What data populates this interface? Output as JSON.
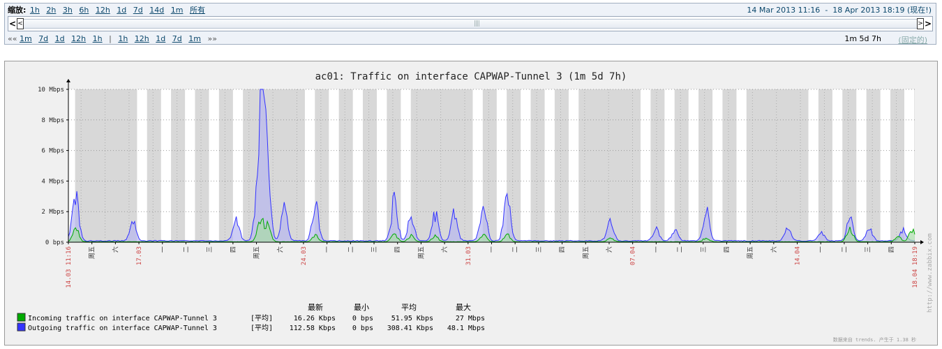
{
  "zoom": {
    "label": "缩放:",
    "links": [
      "1h",
      "2h",
      "3h",
      "6h",
      "12h",
      "1d",
      "7d",
      "14d",
      "1m",
      "所有"
    ]
  },
  "period": {
    "from": "14 Mar 2013 11:16",
    "separator": "-",
    "to": "18 Apr 2013 18:19 (现在!)"
  },
  "nav": {
    "back_prefix": "««",
    "back_links": [
      "1m",
      "7d",
      "1d",
      "12h",
      "1h"
    ],
    "divider": "|",
    "fwd_links": [
      "1h",
      "12h",
      "1d",
      "7d",
      "1m"
    ],
    "fwd_suffix": "»»",
    "duration": "1m 5d 7h",
    "fixed": "(固定的)"
  },
  "graph": {
    "title": "ac01: Traffic on interface CAPWAP-Tunnel 3 (1m 5d 7h)",
    "y_ticks": [
      "0 bps",
      "2 Mbps",
      "4 Mbps",
      "6 Mbps",
      "8 Mbps",
      "10 Mbps"
    ],
    "x_labels": [
      {
        "t": "14.03 11:16",
        "red": true
      },
      {
        "t": "周五",
        "red": false
      },
      {
        "t": "六",
        "red": false
      },
      {
        "t": "17.03",
        "red": true
      },
      {
        "t": "一",
        "red": false
      },
      {
        "t": "二",
        "red": false
      },
      {
        "t": "三",
        "red": false
      },
      {
        "t": "四",
        "red": false
      },
      {
        "t": "周五",
        "red": false
      },
      {
        "t": "六",
        "red": false
      },
      {
        "t": "24.03",
        "red": true
      },
      {
        "t": "一",
        "red": false
      },
      {
        "t": "二",
        "red": false
      },
      {
        "t": "三",
        "red": false
      },
      {
        "t": "四",
        "red": false
      },
      {
        "t": "周五",
        "red": false
      },
      {
        "t": "六",
        "red": false
      },
      {
        "t": "31.03",
        "red": true
      },
      {
        "t": "一",
        "red": false
      },
      {
        "t": "二",
        "red": false
      },
      {
        "t": "三",
        "red": false
      },
      {
        "t": "四",
        "red": false
      },
      {
        "t": "周五",
        "red": false
      },
      {
        "t": "六",
        "red": false
      },
      {
        "t": "07.04",
        "red": true
      },
      {
        "t": "一",
        "red": false
      },
      {
        "t": "二",
        "red": false
      },
      {
        "t": "三",
        "red": false
      },
      {
        "t": "四",
        "red": false
      },
      {
        "t": "周五",
        "red": false
      },
      {
        "t": "六",
        "red": false
      },
      {
        "t": "14.04",
        "red": true
      },
      {
        "t": "一",
        "red": false
      },
      {
        "t": "二",
        "red": false
      },
      {
        "t": "三",
        "red": false
      },
      {
        "t": "四",
        "red": false
      },
      {
        "t": "18.04 18:19",
        "red": true
      }
    ],
    "watermark": "http://www.zabbix.com",
    "footer": "数据来自 trends. 产生于 1.38 秒",
    "legend_headers": [
      "最新",
      "最小",
      "平均",
      "最大"
    ],
    "legend": [
      {
        "color": "#00aa00",
        "name": "Incoming traffic on interface CAPWAP-Tunnel 3",
        "func": "[平均]",
        "last": "16.26 Kbps",
        "min": "0 bps",
        "avg": "51.95 Kbps",
        "max": "27 Mbps"
      },
      {
        "color": "#3333ff",
        "name": "Outgoing traffic on interface CAPWAP-Tunnel 3",
        "func": "[平均]",
        "last": "112.58 Kbps",
        "min": "0 bps",
        "avg": "308.41 Kbps",
        "max": "48.1 Mbps"
      }
    ]
  },
  "chart_data": {
    "type": "area",
    "title": "ac01: Traffic on interface CAPWAP-Tunnel 3 (1m 5d 7h)",
    "ylabel": "",
    "ylim": [
      0,
      10
    ],
    "y_unit": "Mbps",
    "x_range": [
      "14.03 11:16",
      "18.04 18:19"
    ],
    "series": [
      {
        "name": "Outgoing traffic on interface CAPWAP-Tunnel 3",
        "color": "#3333ff",
        "peaks": [
          [
            0.3,
            4.2
          ],
          [
            2.7,
            1.6
          ],
          [
            7.0,
            1.8
          ],
          [
            7.9,
            4.4
          ],
          [
            8.1,
            9.3
          ],
          [
            8.3,
            6.3
          ],
          [
            9.0,
            2.8
          ],
          [
            10.3,
            3.2
          ],
          [
            13.6,
            3.4
          ],
          [
            14.3,
            2.2
          ],
          [
            15.3,
            2.2
          ],
          [
            16.1,
            2.2
          ],
          [
            17.3,
            3.1
          ],
          [
            18.3,
            4.2
          ],
          [
            22.6,
            1.8
          ],
          [
            24.5,
            1.0
          ],
          [
            25.3,
            1.0
          ],
          [
            26.6,
            2.6
          ],
          [
            30.0,
            1.2
          ],
          [
            31.4,
            0.8
          ],
          [
            32.6,
            1.8
          ],
          [
            33.4,
            1.0
          ],
          [
            34.8,
            0.9
          ],
          [
            37.1,
            1.1
          ]
        ]
      },
      {
        "name": "Incoming traffic on interface CAPWAP-Tunnel 3",
        "color": "#00aa00",
        "peaks": [
          [
            0.3,
            1.1
          ],
          [
            8.0,
            1.8
          ],
          [
            8.3,
            1.3
          ],
          [
            10.3,
            0.5
          ],
          [
            13.6,
            0.6
          ],
          [
            14.3,
            0.5
          ],
          [
            15.3,
            0.5
          ],
          [
            17.3,
            0.6
          ],
          [
            18.3,
            0.6
          ],
          [
            22.6,
            0.3
          ],
          [
            26.6,
            0.3
          ],
          [
            32.6,
            1.0
          ],
          [
            34.6,
            0.4
          ],
          [
            35.2,
            1.1
          ]
        ]
      }
    ],
    "grid": true
  }
}
